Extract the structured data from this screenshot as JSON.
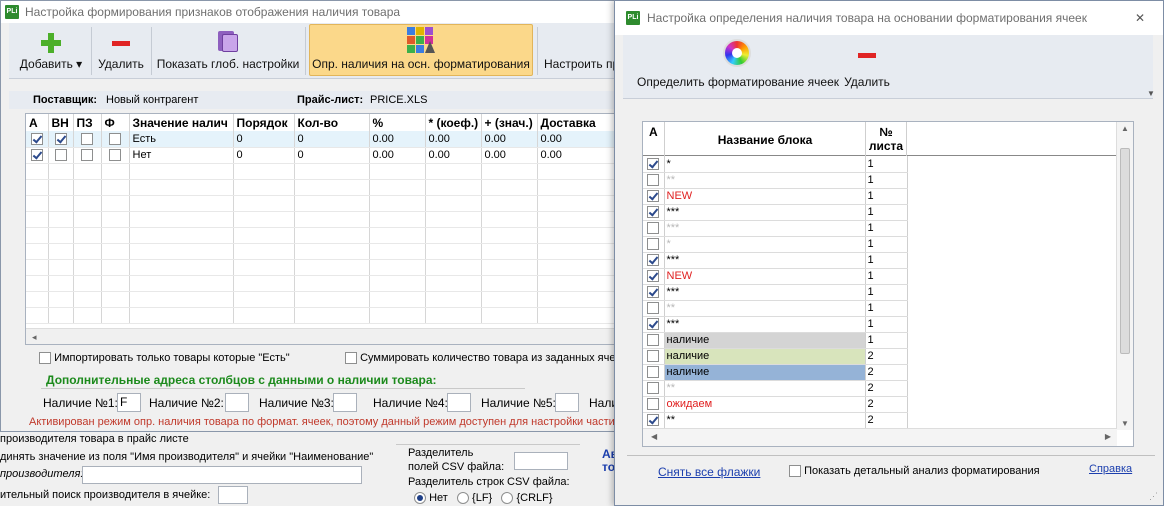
{
  "left_window": {
    "title": "Настройка формирования признаков отображения наличия товара",
    "toolbar": {
      "add": "Добавить",
      "delete": "Удалить",
      "show_global": "Показать глоб. настройки",
      "by_format": "Опр. наличия на осн. форматирования",
      "configure": "Настроить пр"
    },
    "supplier_label": "Поставщик:",
    "supplier_value": "Новый контрагент",
    "pricelist_label": "Прайс-лист:",
    "pricelist_value": "PRICE.XLS",
    "columns": [
      "А",
      "ВН",
      "ПЗ",
      "Ф",
      "Значение налич",
      "Порядок",
      "Кол-во",
      "%",
      "* (коеф.)",
      "+ (знач.)",
      "Доставка"
    ],
    "rows": [
      {
        "a": true,
        "vn": true,
        "pz": false,
        "f": false,
        "value": "Есть",
        "order": "0",
        "qty": "0",
        "pct": "0.00",
        "coef": "0.00",
        "add": "0.00",
        "delivery": "0.00"
      },
      {
        "a": true,
        "vn": false,
        "pz": false,
        "f": false,
        "value": "Нет",
        "order": "0",
        "qty": "0",
        "pct": "0.00",
        "coef": "0.00",
        "add": "0.00",
        "delivery": "0.00"
      }
    ],
    "import_only_label": "Импортировать только товары которые \"Есть\"",
    "sum_qty_label": "Суммировать количество товара из заданных яче",
    "additional_title": "Дополнительные адреса столбцов с данными о наличии товара:",
    "avail": [
      {
        "label": "Наличие №1:",
        "value": "F"
      },
      {
        "label": "Наличие №2:",
        "value": ""
      },
      {
        "label": "Наличие №3:",
        "value": ""
      },
      {
        "label": "Наличие №4:",
        "value": ""
      },
      {
        "label": "Наличие №5:",
        "value": ""
      },
      {
        "label": "Нали",
        "value": ""
      }
    ],
    "warning": "Активирован режим опр. наличия товара по формат. ячеек, поэтому данный режим доступен для настройки части"
  },
  "background": {
    "line1": "производителя товара в прайс листе",
    "line2": "динять значение из поля \"Имя производителя\" и ячейки \"Наименование\"",
    "line3": "производителя:",
    "line4": "ительный поиск производителя в ячейке:",
    "csv_fields_label1": "Разделитель",
    "csv_fields_label2": "полей CSV файла:",
    "csv_rows_label": "Разделитель строк CSV файла:",
    "radio_no": "Нет",
    "radio_lf": "{LF}",
    "radio_crlf": "{CRLF}",
    "right_frag": "Ав",
    "right_frag2": "то"
  },
  "right_window": {
    "title": "Настройка определения наличия товара на основании форматирования ячеек",
    "close": "✕",
    "toolbar": {
      "detect": "Определить форматирование ячеек",
      "delete": "Удалить"
    },
    "col_a": "А",
    "col_name": "Название блока",
    "col_sheet_1": "№",
    "col_sheet_2": "листа",
    "rows": [
      {
        "checked": true,
        "name": "*",
        "sheet": "1",
        "color": "#000000",
        "bg": "#ffffff"
      },
      {
        "checked": false,
        "name": "**",
        "sheet": "1",
        "color": "#b8b8b8",
        "bg": "#ffffff"
      },
      {
        "checked": true,
        "name": "NEW",
        "sheet": "1",
        "color": "#e02020",
        "bg": "#ffffff"
      },
      {
        "checked": true,
        "name": "***",
        "sheet": "1",
        "color": "#000000",
        "bg": "#ffffff"
      },
      {
        "checked": false,
        "name": "***",
        "sheet": "1",
        "color": "#b8b8b8",
        "bg": "#ffffff"
      },
      {
        "checked": false,
        "name": "*",
        "sheet": "1",
        "color": "#b8b8b8",
        "bg": "#ffffff"
      },
      {
        "checked": true,
        "name": "***",
        "sheet": "1",
        "color": "#000000",
        "bg": "#ffffff"
      },
      {
        "checked": true,
        "name": "NEW",
        "sheet": "1",
        "color": "#e02020",
        "bg": "#ffffff"
      },
      {
        "checked": true,
        "name": "***",
        "sheet": "1",
        "color": "#000000",
        "bg": "#ffffff"
      },
      {
        "checked": false,
        "name": "**",
        "sheet": "1",
        "color": "#b8b8b8",
        "bg": "#ffffff"
      },
      {
        "checked": true,
        "name": "***",
        "sheet": "1",
        "color": "#000000",
        "bg": "#ffffff"
      },
      {
        "checked": false,
        "name": "наличие",
        "sheet": "1",
        "color": "#000000",
        "bg": "#d4d4d4"
      },
      {
        "checked": false,
        "name": "наличие",
        "sheet": "2",
        "color": "#000000",
        "bg": "#d8e4bc"
      },
      {
        "checked": false,
        "name": "наличие",
        "sheet": "2",
        "color": "#000000",
        "bg": "#95b3d7"
      },
      {
        "checked": false,
        "name": "**",
        "sheet": "2",
        "color": "#b8b8b8",
        "bg": "#ffffff"
      },
      {
        "checked": false,
        "name": "ожидаем",
        "sheet": "2",
        "color": "#e02020",
        "bg": "#ffffff"
      },
      {
        "checked": true,
        "name": "**",
        "sheet": "2",
        "color": "#000000",
        "bg": "#ffffff"
      }
    ],
    "uncheck_all": "Снять все флажки",
    "show_detailed": "Показать детальный анализ форматирования",
    "help": "Справка"
  },
  "colors": {
    "accent_highlight": "#fbd88a",
    "link": "#1c3fae",
    "green_title": "#1c8a1c",
    "warning": "#c0392b"
  }
}
